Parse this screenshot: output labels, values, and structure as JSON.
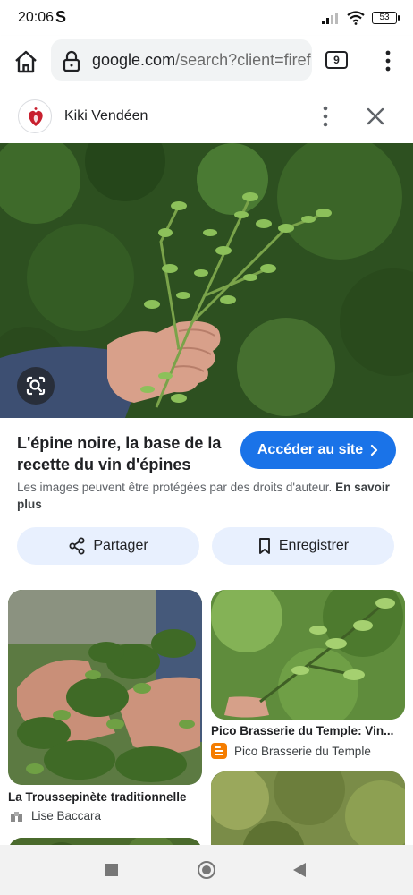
{
  "status_bar": {
    "time": "20:06",
    "carrier_glyph": "S",
    "battery": "53",
    "icons": [
      "signal-icon",
      "wifi-icon",
      "battery-icon"
    ]
  },
  "browser": {
    "url_host": "google.com",
    "url_path": "/search?client=firef",
    "tab_count": "9",
    "icons": [
      "home-icon",
      "lock-icon",
      "tabs-icon",
      "overflow-menu-icon"
    ]
  },
  "source": {
    "name": "Kiki Vendéen",
    "icons": [
      "more-icon",
      "close-icon"
    ]
  },
  "result": {
    "title": "L'épine noire, la base de la recette du vin d'épines",
    "visit_label": "Accéder au site",
    "copyright_text": "Les images peuvent être protégées par des droits d'auteur.",
    "learn_more": "En savoir plus",
    "share_label": "Partager",
    "save_label": "Enregistrer"
  },
  "related": [
    {
      "title": "La Troussepinète traditionnelle",
      "source": "Lise Baccara"
    },
    {
      "title": "Pico Brasserie du Temple: Vin...",
      "source": "Pico Brasserie du Temple"
    }
  ],
  "colors": {
    "accent": "#1a73e8",
    "chip_bg": "#e8f0fe",
    "blogger": "#f57d00"
  }
}
